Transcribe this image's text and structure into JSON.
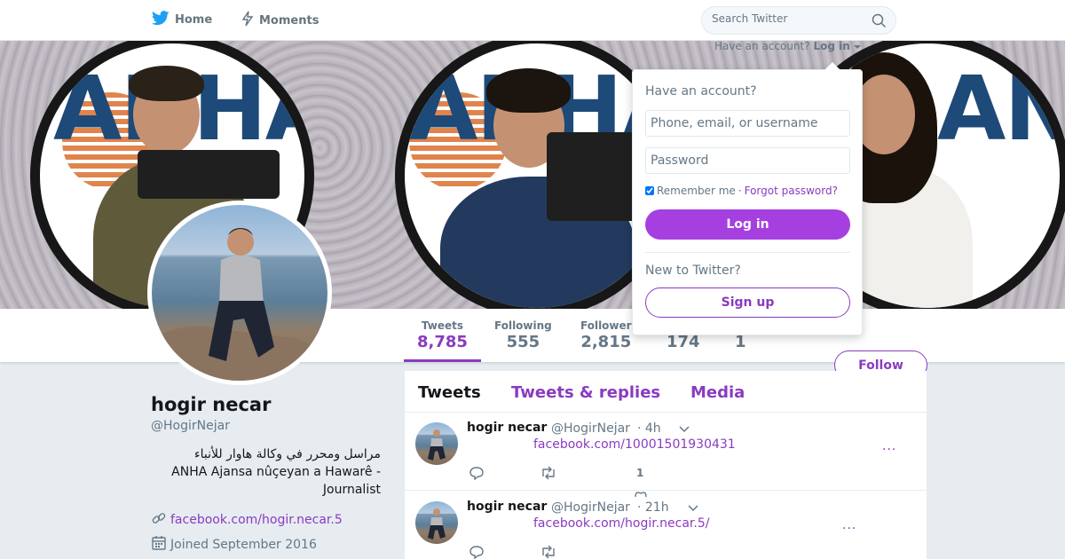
{
  "nav": {
    "home_label": "Home",
    "moments_label": "Moments",
    "search_placeholder": "Search Twitter",
    "account_prompt": "Have an account?",
    "login_toggle": "Log in"
  },
  "banner": {
    "logo_text": "ANHA"
  },
  "profile_nav": {
    "stats": [
      {
        "label": "Tweets",
        "value": "8,785"
      },
      {
        "label": "Following",
        "value": "555"
      },
      {
        "label": "Follower",
        "value": "2,815"
      },
      {
        "label": "",
        "value": "174"
      },
      {
        "label": "",
        "value": "1"
      }
    ],
    "follow_label": "Follow"
  },
  "profile": {
    "name": "hogir necar",
    "handle": "@HogirNejar",
    "bio_line1": "مراسل ومحرر في وكالة هاوار للأنباء",
    "bio_line2": "ANHA Ajansa nûçeyan a Hawarê -",
    "bio_line3": "Journalist",
    "url": "facebook.com/hogir.necar.5",
    "joined": "Joined September 2016"
  },
  "timeline": {
    "tabs": [
      "Tweets",
      "Tweets & replies",
      "Media"
    ],
    "tweets": [
      {
        "name": "hogir necar",
        "handle": "@HogirNejar",
        "time": "· 4h",
        "link": "facebook.com/10001501930431",
        "more": "...",
        "like_count": "1"
      },
      {
        "name": "hogir necar",
        "handle": "@HogirNejar",
        "time": "· 21h",
        "link": "facebook.com/hogir.necar.5/",
        "more": "..."
      }
    ]
  },
  "login_dropdown": {
    "title": "Have an account?",
    "username_placeholder": "Phone, email, or username",
    "password_placeholder": "Password",
    "remember_label": "Remember me",
    "separator": "·",
    "forgot_label": "Forgot password?",
    "login_button": "Log in",
    "new_prompt": "New to Twitter?",
    "signup_button": "Sign up"
  },
  "colors": {
    "accent": "#8a3bc0",
    "login_button": "#a63fe0",
    "twitter_blue": "#1da1f2"
  }
}
